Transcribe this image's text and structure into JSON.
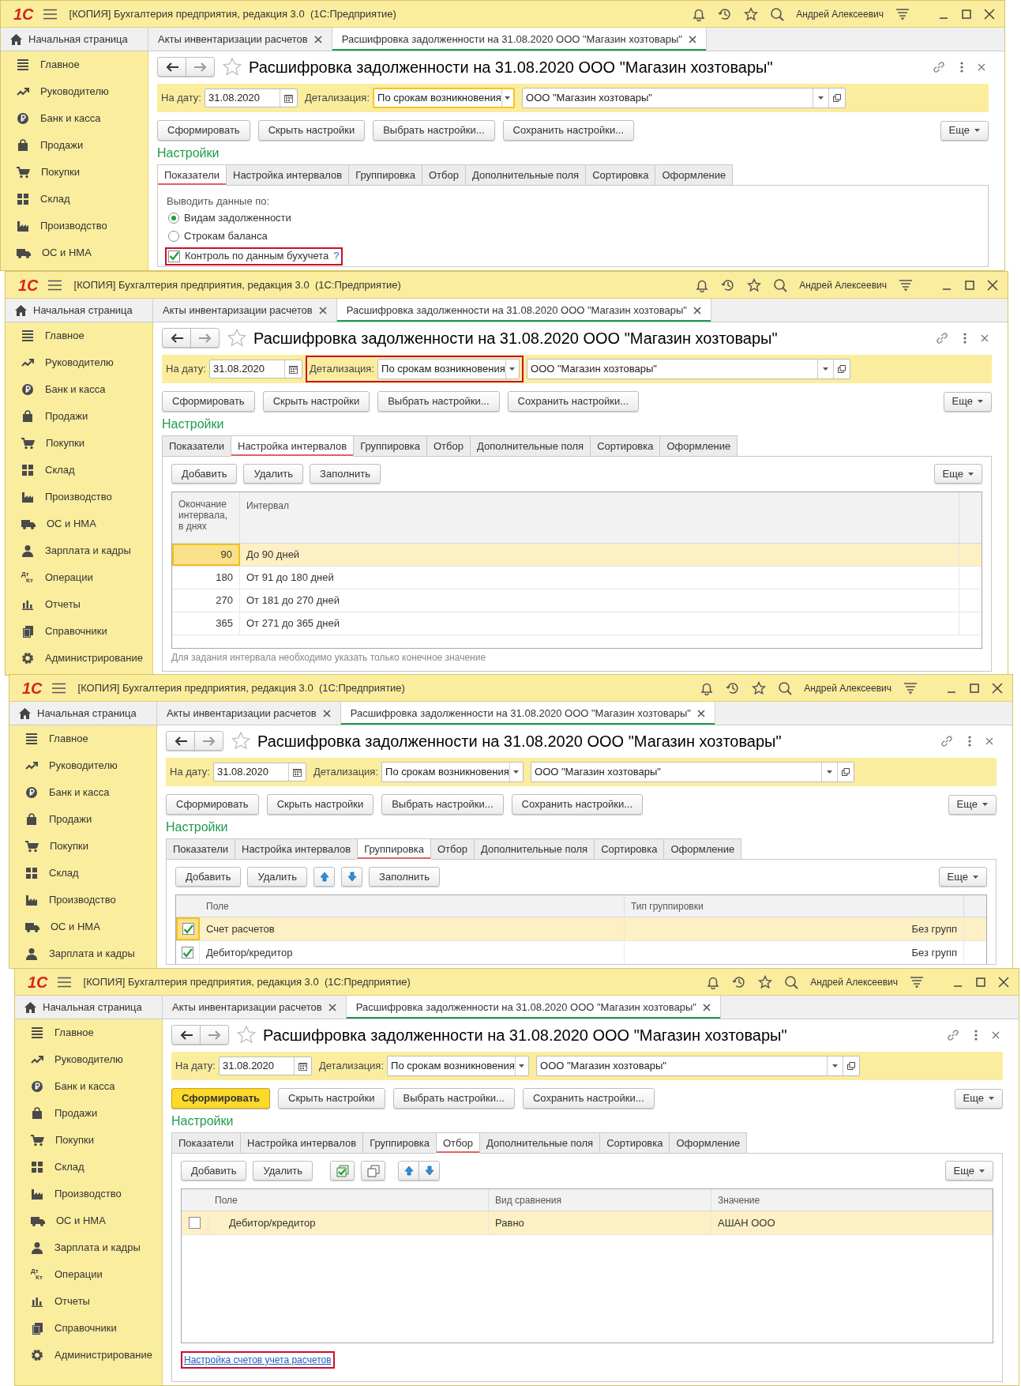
{
  "windows": [
    {
      "title_bar": {
        "logo": "1С",
        "title": "[КОПИЯ] Бухгалтерия предприятия, редакция 3.0  (1С:Предприятие)",
        "user": "Андрей Алексеевич"
      },
      "open_tabs": [
        {
          "label": "Начальная страница",
          "kind": "home",
          "selected": false
        },
        {
          "label": "Акты инвентаризации расчетов",
          "kind": "closable",
          "selected": false
        },
        {
          "label": "Расшифровка задолженности на 31.08.2020 ООО \"Магазин хозтовары\"",
          "kind": "closable",
          "selected": true
        }
      ],
      "sidebar": {
        "items": [
          {
            "label": "Главное"
          },
          {
            "label": "Руководителю"
          },
          {
            "label": "Банк и касса"
          },
          {
            "label": "Продажи"
          },
          {
            "label": "Покупки"
          },
          {
            "label": "Склад"
          },
          {
            "label": "Производство"
          },
          {
            "label": "ОС и НМА"
          }
        ]
      },
      "form": {
        "title": "Расшифровка задолженности на 31.08.2020 ООО \"Магазин хозтовары\"",
        "date_label": "На дату:",
        "date": "31.08.2020",
        "detail_label": "Детализация:",
        "detail": "По срокам возникновения",
        "detail_focused": true,
        "detail_highlighted": false,
        "organization": "ООО \"Магазин хозтовары\"",
        "buttons": [
          {
            "label": "Сформировать",
            "primary": false
          },
          {
            "label": "Скрыть настройки",
            "primary": false
          },
          {
            "label": "Выбрать настройки...",
            "primary": false
          },
          {
            "label": "Сохранить настройки...",
            "primary": false
          }
        ],
        "more": "Еще",
        "settings_heading": "Настройки",
        "settings_tabs": [
          {
            "label": "Показатели",
            "selected": true
          },
          {
            "label": "Настройка интервалов",
            "selected": false
          },
          {
            "label": "Группировка",
            "selected": false
          },
          {
            "label": "Отбор",
            "selected": false
          },
          {
            "label": "Дополнительные поля",
            "selected": false
          },
          {
            "label": "Сортировка",
            "selected": false
          },
          {
            "label": "Оформление",
            "selected": false
          }
        ],
        "panel": {
          "kind": "options",
          "caption": "Выводить данные по:",
          "radios": [
            {
              "label": "Видам задолженности",
              "selected": true
            },
            {
              "label": "Строкам баланса",
              "selected": false
            }
          ],
          "checkbox": {
            "label": "Контроль по данным бухучета",
            "checked": true,
            "highlighted": true,
            "help": "?"
          }
        }
      }
    },
    {
      "title_bar": {
        "logo": "1С",
        "title": "[КОПИЯ] Бухгалтерия предприятия, редакция 3.0  (1С:Предприятие)",
        "user": "Андрей Алексеевич"
      },
      "open_tabs": [
        {
          "label": "Начальная страница",
          "kind": "home",
          "selected": false
        },
        {
          "label": "Акты инвентаризации расчетов",
          "kind": "closable",
          "selected": false
        },
        {
          "label": "Расшифровка задолженности на 31.08.2020 ООО \"Магазин хозтовары\"",
          "kind": "closable",
          "selected": true
        }
      ],
      "sidebar": {
        "items": [
          {
            "label": "Главное"
          },
          {
            "label": "Руководителю"
          },
          {
            "label": "Банк и касса"
          },
          {
            "label": "Продажи"
          },
          {
            "label": "Покупки"
          },
          {
            "label": "Склад"
          },
          {
            "label": "Производство"
          },
          {
            "label": "ОС и НМА"
          },
          {
            "label": "Зарплата и кадры"
          },
          {
            "label": "Операции",
            "icon_text": [
              "Дт",
              "Кт"
            ]
          },
          {
            "label": "Отчеты"
          },
          {
            "label": "Справочники"
          },
          {
            "label": "Администрирование"
          }
        ]
      },
      "form": {
        "title": "Расшифровка задолженности на 31.08.2020 ООО \"Магазин хозтовары\"",
        "date_label": "На дату:",
        "date": "31.08.2020",
        "detail_label": "Детализация:",
        "detail": "По срокам возникновения",
        "detail_focused": false,
        "detail_highlighted": true,
        "organization": "ООО \"Магазин хозтовары\"",
        "buttons": [
          {
            "label": "Сформировать",
            "primary": false
          },
          {
            "label": "Скрыть настройки",
            "primary": false
          },
          {
            "label": "Выбрать настройки...",
            "primary": false
          },
          {
            "label": "Сохранить настройки...",
            "primary": false
          }
        ],
        "more": "Еще",
        "settings_heading": "Настройки",
        "settings_tabs": [
          {
            "label": "Показатели",
            "selected": false
          },
          {
            "label": "Настройка интервалов",
            "selected": true
          },
          {
            "label": "Группировка",
            "selected": false
          },
          {
            "label": "Отбор",
            "selected": false
          },
          {
            "label": "Дополнительные поля",
            "selected": false
          },
          {
            "label": "Сортировка",
            "selected": false
          },
          {
            "label": "Оформление",
            "selected": false
          }
        ],
        "panel": {
          "kind": "intervals",
          "toolbar": [
            {
              "kind": "text",
              "label": "Добавить"
            },
            {
              "kind": "text",
              "label": "Удалить"
            },
            {
              "kind": "text",
              "label": "Заполнить"
            }
          ],
          "more": "Еще",
          "table": {
            "columns": [
              "Окончание интервала, в днях",
              "Интервал"
            ],
            "rows": [
              {
                "cells": [
                  "90",
                  "До 90 дней"
                ],
                "selected": true,
                "focused": true
              },
              {
                "cells": [
                  "180",
                  "От 91 до 180 дней"
                ],
                "selected": false,
                "focused": false
              },
              {
                "cells": [
                  "270",
                  "От 181 до 270 дней"
                ],
                "selected": false,
                "focused": false
              },
              {
                "cells": [
                  "365",
                  "От 271 до 365 дней"
                ],
                "selected": false,
                "focused": false
              }
            ]
          },
          "note": "Для задания интервала необходимо указать только конечное значение"
        }
      }
    },
    {
      "title_bar": {
        "logo": "1С",
        "title": "[КОПИЯ] Бухгалтерия предприятия, редакция 3.0  (1С:Предприятие)",
        "user": "Андрей Алексеевич"
      },
      "open_tabs": [
        {
          "label": "Начальная страница",
          "kind": "home",
          "selected": false
        },
        {
          "label": "Акты инвентаризации расчетов",
          "kind": "closable",
          "selected": false
        },
        {
          "label": "Расшифровка задолженности на 31.08.2020 ООО \"Магазин хозтовары\"",
          "kind": "closable",
          "selected": true
        }
      ],
      "sidebar": {
        "items": [
          {
            "label": "Главное"
          },
          {
            "label": "Руководителю"
          },
          {
            "label": "Банк и касса"
          },
          {
            "label": "Продажи"
          },
          {
            "label": "Покупки"
          },
          {
            "label": "Склад"
          },
          {
            "label": "Производство"
          },
          {
            "label": "ОС и НМА"
          },
          {
            "label": "Зарплата и кадры"
          }
        ]
      },
      "form": {
        "title": "Расшифровка задолженности на 31.08.2020 ООО \"Магазин хозтовары\"",
        "date_label": "На дату:",
        "date": "31.08.2020",
        "detail_label": "Детализация:",
        "detail": "По срокам возникновения",
        "detail_focused": false,
        "detail_highlighted": false,
        "organization": "ООО \"Магазин хозтовары\"",
        "buttons": [
          {
            "label": "Сформировать",
            "primary": false
          },
          {
            "label": "Скрыть настройки",
            "primary": false
          },
          {
            "label": "Выбрать настройки...",
            "primary": false
          },
          {
            "label": "Сохранить настройки...",
            "primary": false
          }
        ],
        "more": "Еще",
        "settings_heading": "Настройки",
        "settings_tabs": [
          {
            "label": "Показатели",
            "selected": false
          },
          {
            "label": "Настройка интервалов",
            "selected": false
          },
          {
            "label": "Группировка",
            "selected": true
          },
          {
            "label": "Отбор",
            "selected": false
          },
          {
            "label": "Дополнительные поля",
            "selected": false
          },
          {
            "label": "Сортировка",
            "selected": false
          },
          {
            "label": "Оформление",
            "selected": false
          }
        ],
        "panel": {
          "kind": "grouping",
          "toolbar": [
            {
              "kind": "text",
              "label": "Добавить"
            },
            {
              "kind": "text",
              "label": "Удалить"
            },
            {
              "kind": "up"
            },
            {
              "kind": "down"
            },
            {
              "kind": "text",
              "label": "Заполнить"
            }
          ],
          "more": "Еще",
          "table": {
            "columns": [
              "Поле",
              "Тип группировки"
            ],
            "rows": [
              {
                "checked": true,
                "cells": [
                  "Счет расчетов",
                  "Без групп"
                ],
                "selected": true,
                "focused": true
              },
              {
                "checked": true,
                "cells": [
                  "Дебитор/кредитор",
                  "Без групп"
                ],
                "selected": false,
                "focused": false
              }
            ]
          }
        }
      }
    },
    {
      "title_bar": {
        "logo": "1С",
        "title": "[КОПИЯ] Бухгалтерия предприятия, редакция 3.0  (1С:Предприятие)",
        "user": "Андрей Алексеевич"
      },
      "open_tabs": [
        {
          "label": "Начальная страница",
          "kind": "home",
          "selected": false
        },
        {
          "label": "Акты инвентаризации расчетов",
          "kind": "closable",
          "selected": false
        },
        {
          "label": "Расшифровка задолженности на 31.08.2020 ООО \"Магазин хозтовары\"",
          "kind": "closable",
          "selected": true
        }
      ],
      "sidebar": {
        "items": [
          {
            "label": "Главное"
          },
          {
            "label": "Руководителю"
          },
          {
            "label": "Банк и касса"
          },
          {
            "label": "Продажи"
          },
          {
            "label": "Покупки"
          },
          {
            "label": "Склад"
          },
          {
            "label": "Производство"
          },
          {
            "label": "ОС и НМА"
          },
          {
            "label": "Зарплата и кадры"
          },
          {
            "label": "Операции",
            "icon_text": [
              "Дт",
              "Кт"
            ]
          },
          {
            "label": "Отчеты"
          },
          {
            "label": "Справочники"
          },
          {
            "label": "Администрирование"
          }
        ]
      },
      "form": {
        "title": "Расшифровка задолженности на 31.08.2020 ООО \"Магазин хозтовары\"",
        "date_label": "На дату:",
        "date": "31.08.2020",
        "detail_label": "Детализация:",
        "detail": "По срокам возникновения",
        "detail_focused": false,
        "detail_highlighted": false,
        "organization": "ООО \"Магазин хозтовары\"",
        "buttons": [
          {
            "label": "Сформировать",
            "primary": true
          },
          {
            "label": "Скрыть настройки",
            "primary": false
          },
          {
            "label": "Выбрать настройки...",
            "primary": false
          },
          {
            "label": "Сохранить настройки...",
            "primary": false
          }
        ],
        "more": "Еще",
        "settings_heading": "Настройки",
        "settings_tabs": [
          {
            "label": "Показатели",
            "selected": false
          },
          {
            "label": "Настройка интервалов",
            "selected": false
          },
          {
            "label": "Группировка",
            "selected": false
          },
          {
            "label": "Отбор",
            "selected": true
          },
          {
            "label": "Дополнительные поля",
            "selected": false
          },
          {
            "label": "Сортировка",
            "selected": false
          },
          {
            "label": "Оформление",
            "selected": false
          }
        ],
        "panel": {
          "kind": "filter",
          "toolbar": [
            {
              "kind": "text",
              "label": "Добавить"
            },
            {
              "kind": "text",
              "label": "Удалить"
            },
            {
              "kind": "check-all"
            },
            {
              "kind": "copy"
            },
            {
              "kind": "up-down"
            }
          ],
          "more": "Еще",
          "table": {
            "columns": [
              "Поле",
              "Вид сравнения",
              "Значение"
            ],
            "rows": [
              {
                "checked": false,
                "cells": [
                  "Дебитор/кредитор",
                  "Равно",
                  "АШАН ООО"
                ],
                "selected": true,
                "focused": false
              }
            ]
          },
          "link": {
            "label": "Настройка счетов учета расчетов",
            "highlighted": true
          }
        }
      }
    }
  ]
}
